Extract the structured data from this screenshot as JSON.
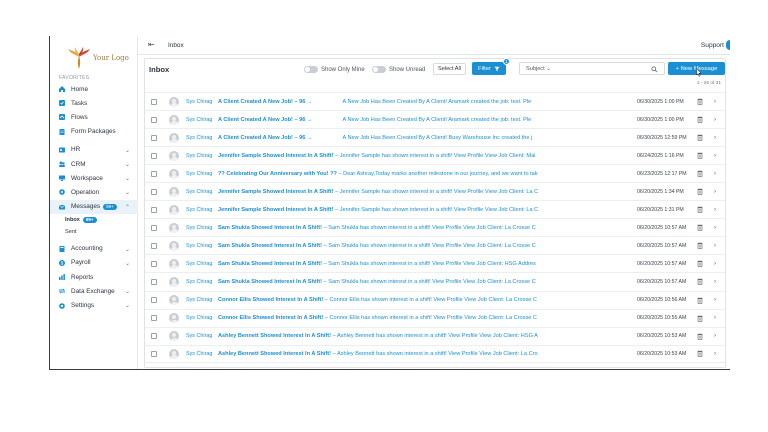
{
  "brand": {
    "logo_text": "Your Logo"
  },
  "sidebar": {
    "section_label": "FAVORITES",
    "items": [
      {
        "label": "Home",
        "icon": "home-icon"
      },
      {
        "label": "Tasks",
        "icon": "tasks-icon"
      },
      {
        "label": "Flows",
        "icon": "flows-icon"
      },
      {
        "label": "Form Packages",
        "icon": "form-icon"
      },
      {
        "label": "HR",
        "icon": "hr-icon"
      },
      {
        "label": "CRM",
        "icon": "crm-icon"
      },
      {
        "label": "Workspace",
        "icon": "workspace-icon"
      },
      {
        "label": "Operation",
        "icon": "operation-icon"
      },
      {
        "label": "Messages",
        "icon": "messages-icon",
        "badge": "99+"
      },
      {
        "label": "Accounting",
        "icon": "accounting-icon"
      },
      {
        "label": "Payroll",
        "icon": "payroll-icon"
      },
      {
        "label": "Reports",
        "icon": "reports-icon"
      },
      {
        "label": "Data Exchange",
        "icon": "data-exchange-icon"
      },
      {
        "label": "Settings",
        "icon": "settings-icon"
      }
    ],
    "messages_sub": [
      {
        "label": "Inbox",
        "badge": "99+"
      },
      {
        "label": "Sent"
      }
    ]
  },
  "topbar": {
    "breadcrumb": "Inbox",
    "support_label": "Support"
  },
  "toolbar": {
    "title": "Inbox",
    "show_only_mine": "Show Only Mine",
    "show_unread": "Show Unread",
    "select_all": "Select All",
    "filter": "Filter",
    "filter_count": "1",
    "subject_select": "Subject",
    "new_message": "+ New Message",
    "pager": "1 - 25 of 31"
  },
  "messages": [
    {
      "sender": "Sys Chirag",
      "subject": "A Client Created A New Job! – 96 →",
      "body": "A New Job Has Been Created By A Client! Aramark created the job: test. Ple",
      "date": "06/30/2025 1:00 PM",
      "gap": true
    },
    {
      "sender": "Sys Chirag",
      "subject": "A Client Created A New Job! – 96 →",
      "body": "A New Job Has Been Created By A Client! Aramark created the job: test. Ple",
      "date": "06/30/2025 1:00 PM",
      "gap": true
    },
    {
      "sender": "Sys Chirag",
      "subject": "A Client Created A New Job! – 96 →",
      "body": "A New Job Has Been Created By A Client! Busy Warehouse Inc created the j",
      "date": "06/30/2025 12:59 PM",
      "gap": true
    },
    {
      "sender": "Sys Chirag",
      "subject": "Jennifer Sample Showed Interest In A Shift!",
      "body": " – Jennifer Sample has shown interest in a shift! View Profile View Job Client: Mai",
      "date": "06/24/2025 1:16 PM"
    },
    {
      "sender": "Sys Chirag",
      "subject": "?? Celebrating Our Anniversary with You! ??",
      "body": " – Dear Ashray,Today marks another milestone in our journey, and we want to tak",
      "date": "06/23/2025 12:17 PM"
    },
    {
      "sender": "Sys Chirag",
      "subject": "Jennifer Sample Showed Interest In A Shift!",
      "body": " – Jennifer Sample has shown interest in a shift! View Profile View Job Client: La C",
      "date": "06/20/2025 1:34 PM"
    },
    {
      "sender": "Sys Chirag",
      "subject": "Jennifer Sample Showed Interest In A Shift!",
      "body": " – Jennifer Sample has shown interest in a shift! View Profile View Job Client: La C",
      "date": "06/20/2025 1:31 PM"
    },
    {
      "sender": "Sys Chirag",
      "subject": "Sam Shukla Showed Interest In A Shift!",
      "body": " – Sam Shukla has shown interest in a shift! View Profile View Job Client: La Crosse C",
      "date": "06/20/2025 10:57 AM"
    },
    {
      "sender": "Sys Chirag",
      "subject": "Sam Shukla Showed Interest In A Shift!",
      "body": " – Sam Shukla has shown interest in a shift! View Profile View Job Client: La Crosse C",
      "date": "06/20/2025 10:57 AM"
    },
    {
      "sender": "Sys Chirag",
      "subject": "Sam Shukla Showed Interest In A Shift!",
      "body": " – Sam Shukla has shown interest in a shift! View Profile View Job Client: HSG Addres",
      "date": "06/20/2025 10:57 AM"
    },
    {
      "sender": "Sys Chirag",
      "subject": "Sam Shukla Showed Interest In A Shift!",
      "body": " – Sam Shukla has shown interest in a shift! View Profile View Job Client: La Crosse C",
      "date": "06/20/2025 10:57 AM"
    },
    {
      "sender": "Sys Chirag",
      "subject": "Connor Ellis Showed Interest In A Shift!",
      "body": " – Connor Ellis has shown interest in a shift! View Profile View Job Client: La Crosse C",
      "date": "06/20/2025 10:56 AM"
    },
    {
      "sender": "Sys Chirag",
      "subject": "Connor Ellis Showed Interest In A Shift!",
      "body": " – Connor Ellis has shown interest in a shift! View Profile View Job Client: La Crosse C",
      "date": "06/20/2025 10:55 AM"
    },
    {
      "sender": "Sys Chirag",
      "subject": "Ashley Bennett Showed Interest In A Shift!",
      "body": " – Ashley Bennett has shown interest in a shift! View Profile View Job Client: HSG A",
      "date": "06/20/2025 10:53 AM"
    },
    {
      "sender": "Sys Chirag",
      "subject": "Ashley Bennett Showed Interest In A Shift!",
      "body": " – Ashley Bennett has shown interest in a shift! View Profile View Job Client: La Cro",
      "date": "06/20/2025 10:53 AM"
    }
  ],
  "colors": {
    "accent": "#1a8fd1",
    "text": "#2a3440",
    "border": "#e3e6ea"
  }
}
